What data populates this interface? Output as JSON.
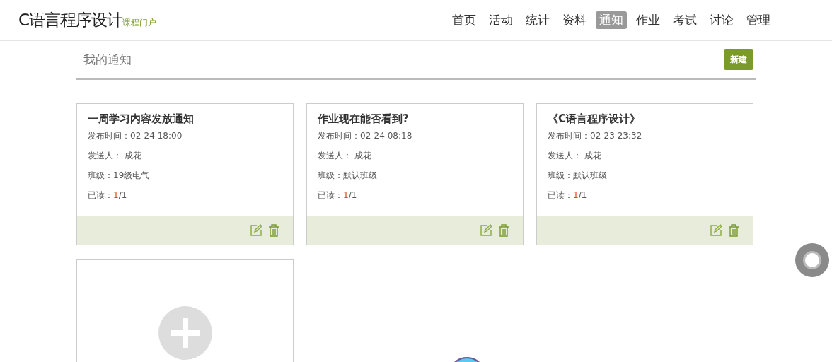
{
  "header": {
    "title": "C语言程序设计",
    "subtitle": "课程门户"
  },
  "nav": [
    {
      "label": "首页",
      "selected": false
    },
    {
      "label": "活动",
      "selected": false
    },
    {
      "label": "统计",
      "selected": false
    },
    {
      "label": "资料",
      "selected": false
    },
    {
      "label": "通知",
      "selected": true
    },
    {
      "label": "作业",
      "selected": false
    },
    {
      "label": "考试",
      "selected": false
    },
    {
      "label": "讨论",
      "selected": false
    },
    {
      "label": "管理",
      "selected": false
    }
  ],
  "section": {
    "title": "我的通知",
    "new_button": "新建"
  },
  "notices": [
    {
      "title": "一周学习内容发放通知",
      "time": "发布时间：02-24 18:00",
      "sender": "发送人： 成花",
      "class": "班级：19级电气",
      "read_label": "已读：",
      "read_count": "1",
      "read_total": "/1"
    },
    {
      "title": "作业现在能否看到?",
      "time": "发布时间：02-24 08:18",
      "sender": "发送人： 成花",
      "class": "班级：默认班级",
      "read_label": "已读：",
      "read_count": "1",
      "read_total": "/1"
    },
    {
      "title": "《C语言程序设计》",
      "time": "发布时间：02-23 23:32",
      "sender": "发送人： 成花",
      "class": "班级：默认班级",
      "read_label": "已读：",
      "read_count": "1",
      "read_total": "/1"
    }
  ]
}
